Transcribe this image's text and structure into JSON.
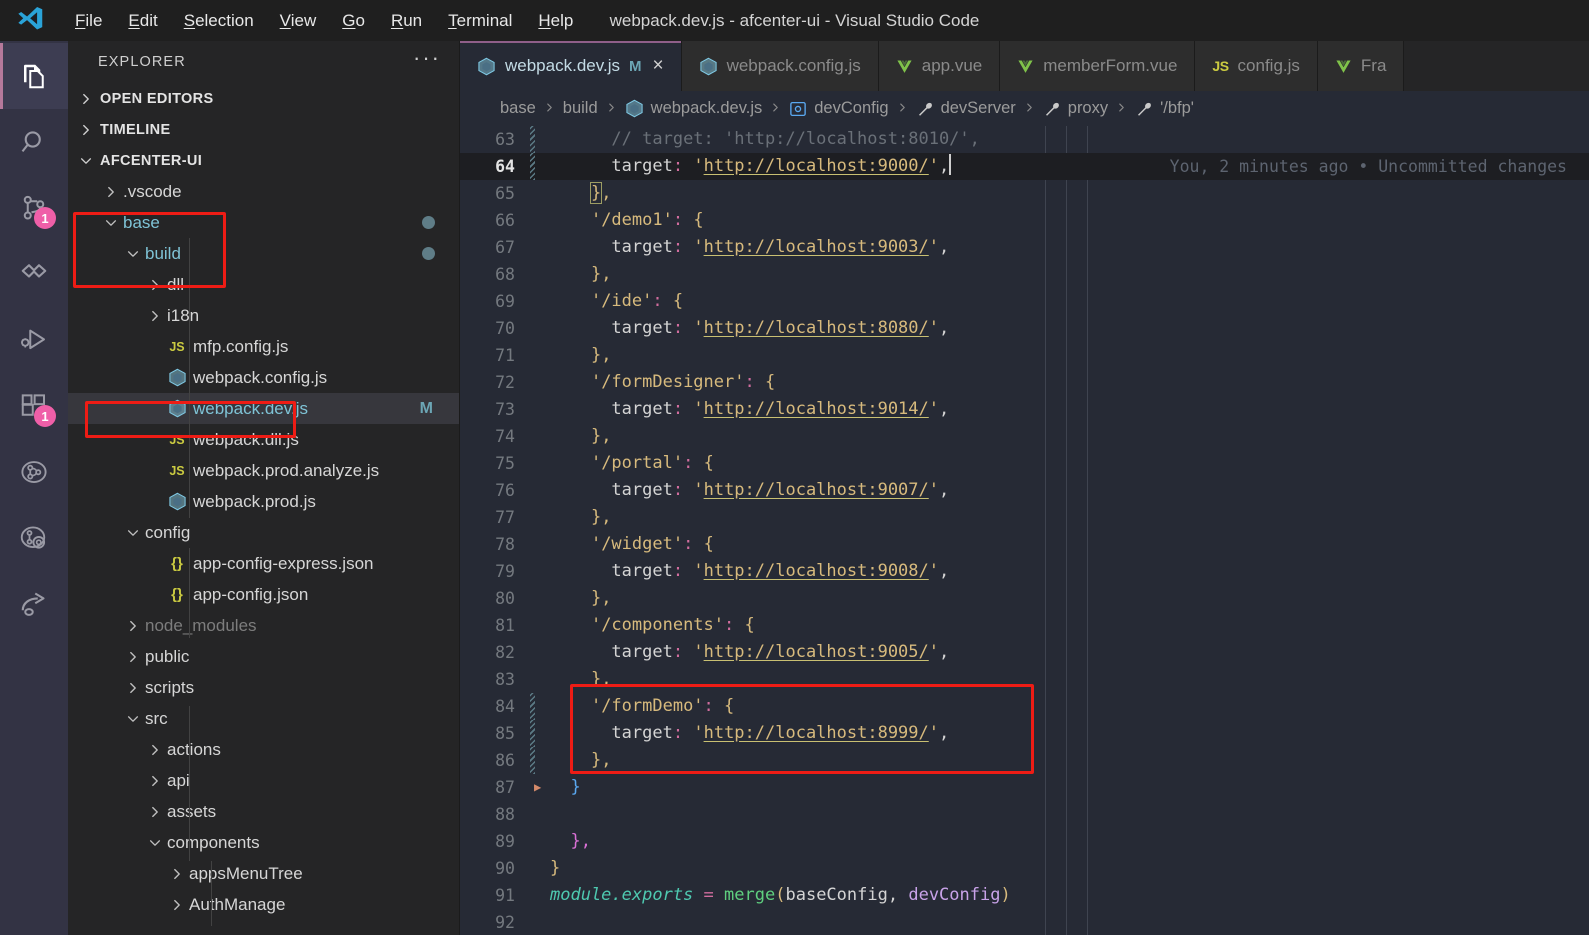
{
  "window": {
    "title": "webpack.dev.js - afcenter-ui - Visual Studio Code",
    "logo_icon": "vscode-logo-icon"
  },
  "menubar": {
    "items": [
      {
        "label": "File",
        "mnemonic": "F"
      },
      {
        "label": "Edit",
        "mnemonic": "E"
      },
      {
        "label": "Selection",
        "mnemonic": "S"
      },
      {
        "label": "View",
        "mnemonic": "V"
      },
      {
        "label": "Go",
        "mnemonic": "G"
      },
      {
        "label": "Run",
        "mnemonic": "R"
      },
      {
        "label": "Terminal",
        "mnemonic": "T"
      },
      {
        "label": "Help",
        "mnemonic": "H"
      }
    ]
  },
  "activitybar": {
    "items": [
      {
        "name": "explorer",
        "icon": "files-icon",
        "active": true,
        "badge": ""
      },
      {
        "name": "search",
        "icon": "search-icon",
        "active": false,
        "badge": ""
      },
      {
        "name": "source-control",
        "icon": "source-control-icon",
        "active": false,
        "badge": "1"
      },
      {
        "name": "sync",
        "icon": "sync-icon",
        "active": false,
        "badge": ""
      },
      {
        "name": "run-and-debug",
        "icon": "run-debug-icon",
        "active": false,
        "badge": ""
      },
      {
        "name": "extensions",
        "icon": "extensions-icon",
        "active": false,
        "badge": "1"
      },
      {
        "name": "git-graph",
        "icon": "git-graph-icon",
        "active": false,
        "badge": ""
      },
      {
        "name": "git-lens",
        "icon": "gitlens-icon",
        "active": false,
        "badge": ""
      },
      {
        "name": "share",
        "icon": "share-icon",
        "active": false,
        "badge": ""
      }
    ]
  },
  "sidebar": {
    "title": "EXPLORER",
    "more_label": "···",
    "sections": [
      {
        "label": "OPEN EDITORS",
        "expanded": false
      },
      {
        "label": "TIMELINE",
        "expanded": false
      },
      {
        "label": "AFCENTER-UI",
        "expanded": true
      }
    ],
    "tree": [
      {
        "label": ".vscode",
        "depth": 1,
        "type": "folder",
        "expanded": false,
        "selected": false,
        "decor": "",
        "dot": false,
        "dim": false
      },
      {
        "label": "base",
        "depth": 1,
        "type": "folder",
        "expanded": true,
        "selected": false,
        "decor": "",
        "dot": true,
        "dim": false
      },
      {
        "label": "build",
        "depth": 2,
        "type": "folder",
        "expanded": true,
        "selected": false,
        "decor": "",
        "dot": true,
        "dim": false
      },
      {
        "label": "dll",
        "depth": 3,
        "type": "folder",
        "expanded": false,
        "selected": false,
        "decor": "",
        "dot": false,
        "dim": false
      },
      {
        "label": "i18n",
        "depth": 3,
        "type": "folder",
        "expanded": false,
        "selected": false,
        "decor": "",
        "dot": false,
        "dim": false
      },
      {
        "label": "mfp.config.js",
        "depth": 3,
        "type": "js",
        "expanded": false,
        "selected": false,
        "decor": "",
        "dot": false,
        "dim": false
      },
      {
        "label": "webpack.config.js",
        "depth": 3,
        "type": "webpack",
        "expanded": false,
        "selected": false,
        "decor": "",
        "dot": false,
        "dim": false
      },
      {
        "label": "webpack.dev.js",
        "depth": 3,
        "type": "webpack",
        "expanded": false,
        "selected": true,
        "decor": "M",
        "dot": false,
        "dim": false
      },
      {
        "label": "webpack.dll.js",
        "depth": 3,
        "type": "js",
        "expanded": false,
        "selected": false,
        "decor": "",
        "dot": false,
        "dim": false
      },
      {
        "label": "webpack.prod.analyze.js",
        "depth": 3,
        "type": "js",
        "expanded": false,
        "selected": false,
        "decor": "",
        "dot": false,
        "dim": false
      },
      {
        "label": "webpack.prod.js",
        "depth": 3,
        "type": "webpack",
        "expanded": false,
        "selected": false,
        "decor": "",
        "dot": false,
        "dim": false
      },
      {
        "label": "config",
        "depth": 2,
        "type": "folder",
        "expanded": true,
        "selected": false,
        "decor": "",
        "dot": false,
        "dim": false
      },
      {
        "label": "app-config-express.json",
        "depth": 3,
        "type": "json",
        "expanded": false,
        "selected": false,
        "decor": "",
        "dot": false,
        "dim": false
      },
      {
        "label": "app-config.json",
        "depth": 3,
        "type": "json",
        "expanded": false,
        "selected": false,
        "decor": "",
        "dot": false,
        "dim": false
      },
      {
        "label": "node_modules",
        "depth": 2,
        "type": "folder",
        "expanded": false,
        "selected": false,
        "decor": "",
        "dot": false,
        "dim": true
      },
      {
        "label": "public",
        "depth": 2,
        "type": "folder",
        "expanded": false,
        "selected": false,
        "decor": "",
        "dot": false,
        "dim": false
      },
      {
        "label": "scripts",
        "depth": 2,
        "type": "folder",
        "expanded": false,
        "selected": false,
        "decor": "",
        "dot": false,
        "dim": false
      },
      {
        "label": "src",
        "depth": 2,
        "type": "folder",
        "expanded": true,
        "selected": false,
        "decor": "",
        "dot": false,
        "dim": false
      },
      {
        "label": "actions",
        "depth": 3,
        "type": "folder",
        "expanded": false,
        "selected": false,
        "decor": "",
        "dot": false,
        "dim": false
      },
      {
        "label": "api",
        "depth": 3,
        "type": "folder",
        "expanded": false,
        "selected": false,
        "decor": "",
        "dot": false,
        "dim": false
      },
      {
        "label": "assets",
        "depth": 3,
        "type": "folder",
        "expanded": false,
        "selected": false,
        "decor": "",
        "dot": false,
        "dim": false
      },
      {
        "label": "components",
        "depth": 3,
        "type": "folder",
        "expanded": true,
        "selected": false,
        "decor": "",
        "dot": false,
        "dim": false
      },
      {
        "label": "appsMenuTree",
        "depth": 4,
        "type": "folder",
        "expanded": false,
        "selected": false,
        "decor": "",
        "dot": false,
        "dim": false
      },
      {
        "label": "AuthManage",
        "depth": 4,
        "type": "folder",
        "expanded": false,
        "selected": false,
        "decor": "",
        "dot": false,
        "dim": false
      }
    ]
  },
  "tabs": [
    {
      "label": "webpack.dev.js",
      "icon": "webpack-icon",
      "active": true,
      "modified": "M",
      "closable": true
    },
    {
      "label": "webpack.config.js",
      "icon": "webpack-icon",
      "active": false,
      "modified": "",
      "closable": false
    },
    {
      "label": "app.vue",
      "icon": "vue-icon",
      "active": false,
      "modified": "",
      "closable": false
    },
    {
      "label": "memberForm.vue",
      "icon": "vue-icon",
      "active": false,
      "modified": "",
      "closable": false
    },
    {
      "label": "config.js",
      "icon": "js-icon",
      "active": false,
      "modified": "",
      "closable": false
    },
    {
      "label": "Fra",
      "icon": "vue-icon",
      "active": false,
      "modified": "",
      "closable": false
    }
  ],
  "breadcrumbs": [
    {
      "label": "base",
      "icon": ""
    },
    {
      "label": "build",
      "icon": ""
    },
    {
      "label": "webpack.dev.js",
      "icon": "webpack-icon"
    },
    {
      "label": "devConfig",
      "icon": "object-icon"
    },
    {
      "label": "devServer",
      "icon": "property-icon"
    },
    {
      "label": "proxy",
      "icon": "property-icon"
    },
    {
      "label": "'/bfp'",
      "icon": "property-icon"
    }
  ],
  "editor": {
    "blame": "You, 2 minutes ago • Uncommitted changes",
    "first_line": 63,
    "lines": [
      {
        "n": 63,
        "text": "      // target: 'http://localhost:8010/',",
        "active": false,
        "diff": true,
        "fold": false
      },
      {
        "n": 64,
        "text": "      target: 'http://localhost:9000/',",
        "active": true,
        "diff": true,
        "fold": false
      },
      {
        "n": 65,
        "text": "    },",
        "active": false,
        "diff": false,
        "fold": false
      },
      {
        "n": 66,
        "text": "    '/demo1': {",
        "active": false,
        "diff": false,
        "fold": false
      },
      {
        "n": 67,
        "text": "      target: 'http://localhost:9003/',",
        "active": false,
        "diff": false,
        "fold": false
      },
      {
        "n": 68,
        "text": "    },",
        "active": false,
        "diff": false,
        "fold": false
      },
      {
        "n": 69,
        "text": "    '/ide': {",
        "active": false,
        "diff": false,
        "fold": false
      },
      {
        "n": 70,
        "text": "      target: 'http://localhost:8080/',",
        "active": false,
        "diff": false,
        "fold": false
      },
      {
        "n": 71,
        "text": "    },",
        "active": false,
        "diff": false,
        "fold": false
      },
      {
        "n": 72,
        "text": "    '/formDesigner': {",
        "active": false,
        "diff": false,
        "fold": false
      },
      {
        "n": 73,
        "text": "      target: 'http://localhost:9014/',",
        "active": false,
        "diff": false,
        "fold": false
      },
      {
        "n": 74,
        "text": "    },",
        "active": false,
        "diff": false,
        "fold": false
      },
      {
        "n": 75,
        "text": "    '/portal': {",
        "active": false,
        "diff": false,
        "fold": false
      },
      {
        "n": 76,
        "text": "      target: 'http://localhost:9007/',",
        "active": false,
        "diff": false,
        "fold": false
      },
      {
        "n": 77,
        "text": "    },",
        "active": false,
        "diff": false,
        "fold": false
      },
      {
        "n": 78,
        "text": "    '/widget': {",
        "active": false,
        "diff": false,
        "fold": false
      },
      {
        "n": 79,
        "text": "      target: 'http://localhost:9008/',",
        "active": false,
        "diff": false,
        "fold": false
      },
      {
        "n": 80,
        "text": "    },",
        "active": false,
        "diff": false,
        "fold": false
      },
      {
        "n": 81,
        "text": "    '/components': {",
        "active": false,
        "diff": false,
        "fold": false
      },
      {
        "n": 82,
        "text": "      target: 'http://localhost:9005/',",
        "active": false,
        "diff": false,
        "fold": false
      },
      {
        "n": 83,
        "text": "    },",
        "active": false,
        "diff": false,
        "fold": false
      },
      {
        "n": 84,
        "text": "    '/formDemo': {",
        "active": false,
        "diff": true,
        "fold": false
      },
      {
        "n": 85,
        "text": "      target: 'http://localhost:8999/',",
        "active": false,
        "diff": true,
        "fold": false
      },
      {
        "n": 86,
        "text": "    },",
        "active": false,
        "diff": true,
        "fold": false
      },
      {
        "n": 87,
        "text": "  }",
        "active": false,
        "diff": false,
        "fold": true
      },
      {
        "n": 88,
        "text": "",
        "active": false,
        "diff": false,
        "fold": false
      },
      {
        "n": 89,
        "text": "  },",
        "active": false,
        "diff": false,
        "fold": false
      },
      {
        "n": 90,
        "text": "}",
        "active": false,
        "diff": false,
        "fold": false
      },
      {
        "n": 91,
        "text": "module.exports = merge(baseConfig, devConfig)",
        "active": false,
        "diff": false,
        "fold": false
      },
      {
        "n": 92,
        "text": "",
        "active": false,
        "diff": false,
        "fold": false
      }
    ]
  },
  "annotations": [
    {
      "name": "annotation-base-build",
      "color": "#ee1c15"
    },
    {
      "name": "annotation-webpack-dev-js",
      "color": "#ee1c15"
    },
    {
      "name": "annotation-formdemo-block",
      "color": "#ee1c15"
    }
  ]
}
